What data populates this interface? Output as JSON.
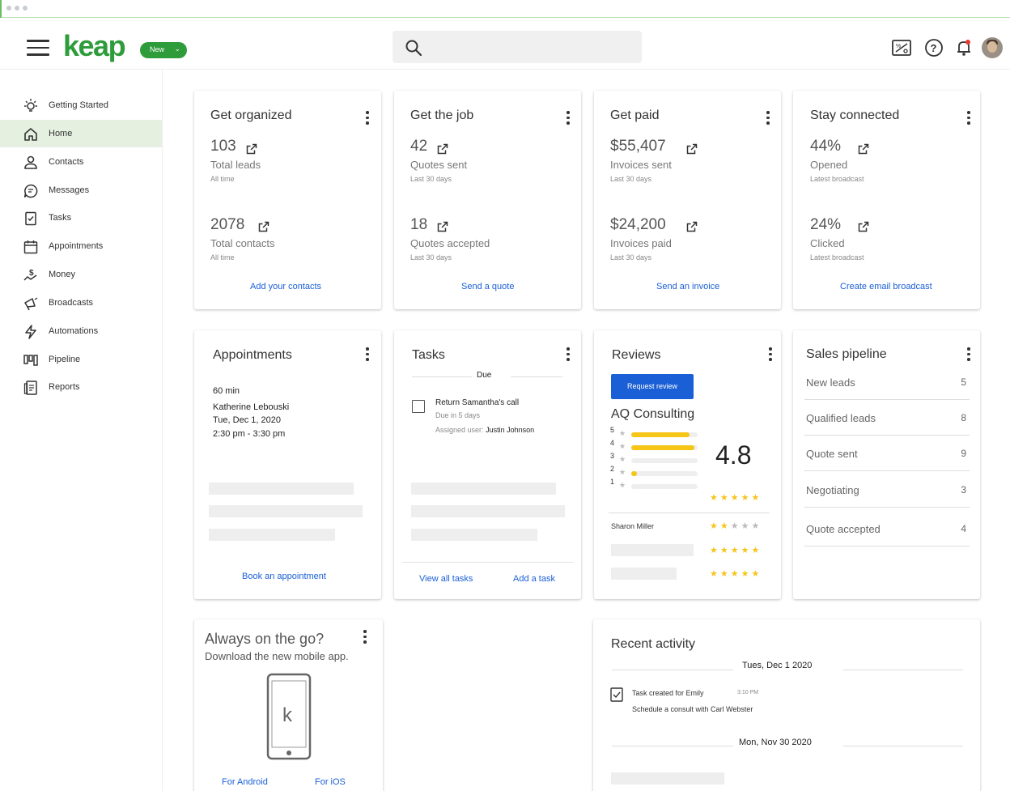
{
  "app": {
    "logo_text": "keap",
    "new_label": "New",
    "brand_color": "#2e9c3a"
  },
  "sidebar": {
    "items": [
      {
        "label": "Getting Started",
        "icon": "lightbulb-icon"
      },
      {
        "label": "Home",
        "icon": "home-icon"
      },
      {
        "label": "Contacts",
        "icon": "person-icon"
      },
      {
        "label": "Messages",
        "icon": "chat-icon"
      },
      {
        "label": "Tasks",
        "icon": "checklist-icon"
      },
      {
        "label": "Appointments",
        "icon": "calendar-icon"
      },
      {
        "label": "Money",
        "icon": "money-icon"
      },
      {
        "label": "Broadcasts",
        "icon": "megaphone-icon"
      },
      {
        "label": "Automations",
        "icon": "bolt-icon"
      },
      {
        "label": "Pipeline",
        "icon": "pipeline-icon"
      },
      {
        "label": "Reports",
        "icon": "report-icon"
      }
    ]
  },
  "cards": {
    "organized": {
      "title": "Get organized",
      "s1": "103",
      "s1_sub": "Total leads",
      "s1_tiny": "All time",
      "s2": "2078",
      "s2_sub": "Total contacts",
      "s2_tiny": "All time",
      "link": "Add your contacts"
    },
    "job": {
      "title": "Get the job",
      "s1": "42",
      "s1_sub": "Quotes sent",
      "s1_tiny": "Last 30 days",
      "s2": "18",
      "s2_sub": "Quotes accepted",
      "s2_tiny": "Last 30 days",
      "link": "Send a quote"
    },
    "paid": {
      "title": "Get paid",
      "s1": "$55,407",
      "s1_sub": "Invoices sent",
      "s1_tiny": "Last 30 days",
      "s2": "$24,200",
      "s2_sub": "Invoices paid",
      "s2_tiny": "Last 30 days",
      "link": "Send an invoice"
    },
    "connected": {
      "title": "Stay connected",
      "s1": "44%",
      "s1_sub": "Opened",
      "s1_tiny": "Latest broadcast",
      "s2": "24%",
      "s2_sub": "Clicked",
      "s2_tiny": "Latest broadcast",
      "link": "Create email broadcast"
    }
  },
  "appointments": {
    "title": "Appointments",
    "duration": "60 min",
    "name": "Katherine Lebouski",
    "date": "Tue, Dec 1, 2020",
    "time": "2:30 pm - 3:30 pm",
    "link": "Book an appointment"
  },
  "tasks": {
    "title": "Tasks",
    "due_label": "Due",
    "task": "Return Samantha's call",
    "due": "Due in 5 days",
    "assigned_label": "Assigned user:",
    "assigned_user": "Justin Johnson",
    "link1": "View all tasks",
    "link2": "Add a task"
  },
  "reviews": {
    "title": "Reviews",
    "button": "Request review",
    "business": "AQ Consulting",
    "rating": "4.8",
    "rating_stars": 4.8,
    "bars": [
      {
        "star": "5",
        "fraction": 0.88
      },
      {
        "star": "4",
        "fraction": 0.95
      },
      {
        "star": "3",
        "fraction": 0
      },
      {
        "star": "2",
        "fraction": 0.08
      },
      {
        "star": "1",
        "fraction": 0
      }
    ],
    "reviewer": "Sharon Miller",
    "reviewer_stars": 2,
    "review2_stars": 5,
    "review3_stars": 5
  },
  "pipeline": {
    "title": "Sales pipeline",
    "rows": [
      {
        "name": "New leads",
        "count": "5"
      },
      {
        "name": "Qualified leads",
        "count": "8"
      },
      {
        "name": "Quote sent",
        "count": "9"
      },
      {
        "name": "Negotiating",
        "count": "3"
      },
      {
        "name": "Quote accepted",
        "count": "4"
      }
    ]
  },
  "mobile": {
    "title": "Always on the go?",
    "subtitle": "Download the new mobile app.",
    "android": "For Android",
    "ios": "For iOS"
  },
  "activity": {
    "title": "Recent activity",
    "date1": "Tues, Dec 1 2020",
    "item_title": "Task created for Emily",
    "item_time": "3:10 PM",
    "item_desc": "Schedule a consult with Carl Webster",
    "date2": "Mon, Nov 30 2020"
  }
}
